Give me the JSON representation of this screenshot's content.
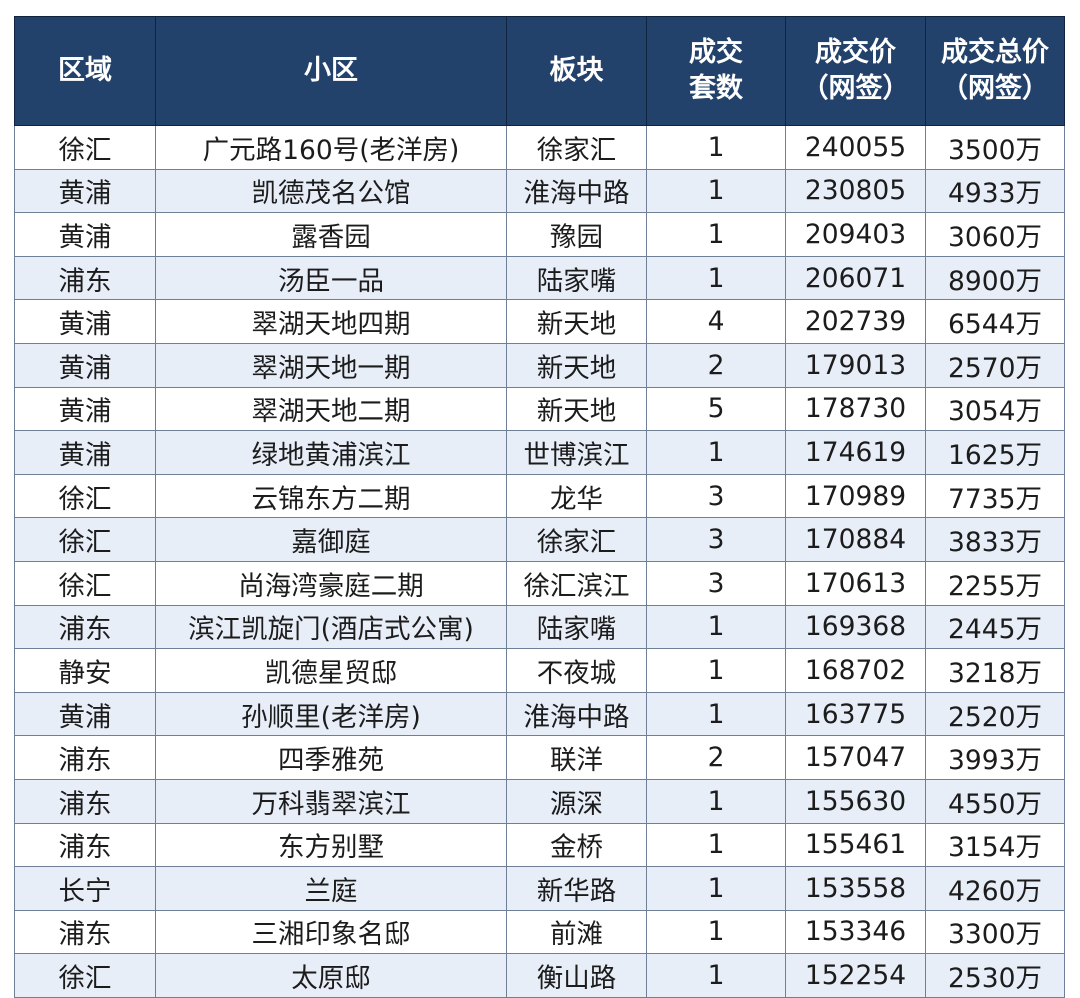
{
  "table": {
    "headers": [
      {
        "lines": [
          "区域"
        ]
      },
      {
        "lines": [
          "小区"
        ]
      },
      {
        "lines": [
          "板块"
        ]
      },
      {
        "lines": [
          "成交",
          "套数"
        ]
      },
      {
        "lines": [
          "成交价",
          "（网签）"
        ]
      },
      {
        "lines": [
          "成交总价",
          "（网签）"
        ]
      }
    ],
    "rows": [
      [
        "徐汇",
        "广元路160号(老洋房)",
        "徐家汇",
        "1",
        "240055",
        "3500万"
      ],
      [
        "黄浦",
        "凯德茂名公馆",
        "淮海中路",
        "1",
        "230805",
        "4933万"
      ],
      [
        "黄浦",
        "露香园",
        "豫园",
        "1",
        "209403",
        "3060万"
      ],
      [
        "浦东",
        "汤臣一品",
        "陆家嘴",
        "1",
        "206071",
        "8900万"
      ],
      [
        "黄浦",
        "翠湖天地四期",
        "新天地",
        "4",
        "202739",
        "6544万"
      ],
      [
        "黄浦",
        "翠湖天地一期",
        "新天地",
        "2",
        "179013",
        "2570万"
      ],
      [
        "黄浦",
        "翠湖天地二期",
        "新天地",
        "5",
        "178730",
        "3054万"
      ],
      [
        "黄浦",
        "绿地黄浦滨江",
        "世博滨江",
        "1",
        "174619",
        "1625万"
      ],
      [
        "徐汇",
        "云锦东方二期",
        "龙华",
        "3",
        "170989",
        "7735万"
      ],
      [
        "徐汇",
        "嘉御庭",
        "徐家汇",
        "3",
        "170884",
        "3833万"
      ],
      [
        "徐汇",
        "尚海湾豪庭二期",
        "徐汇滨江",
        "3",
        "170613",
        "2255万"
      ],
      [
        "浦东",
        "滨江凯旋门(酒店式公寓)",
        "陆家嘴",
        "1",
        "169368",
        "2445万"
      ],
      [
        "静安",
        "凯德星贸邸",
        "不夜城",
        "1",
        "168702",
        "3218万"
      ],
      [
        "黄浦",
        "孙顺里(老洋房)",
        "淮海中路",
        "1",
        "163775",
        "2520万"
      ],
      [
        "浦东",
        "四季雅苑",
        "联洋",
        "2",
        "157047",
        "3993万"
      ],
      [
        "浦东",
        "万科翡翠滨江",
        "源深",
        "1",
        "155630",
        "4550万"
      ],
      [
        "浦东",
        "东方别墅",
        "金桥",
        "1",
        "155461",
        "3154万"
      ],
      [
        "长宁",
        "兰庭",
        "新华路",
        "1",
        "153558",
        "4260万"
      ],
      [
        "浦东",
        "三湘印象名邸",
        "前滩",
        "1",
        "153346",
        "3300万"
      ],
      [
        "徐汇",
        "太原邸",
        "衡山路",
        "1",
        "152254",
        "2530万"
      ]
    ]
  }
}
